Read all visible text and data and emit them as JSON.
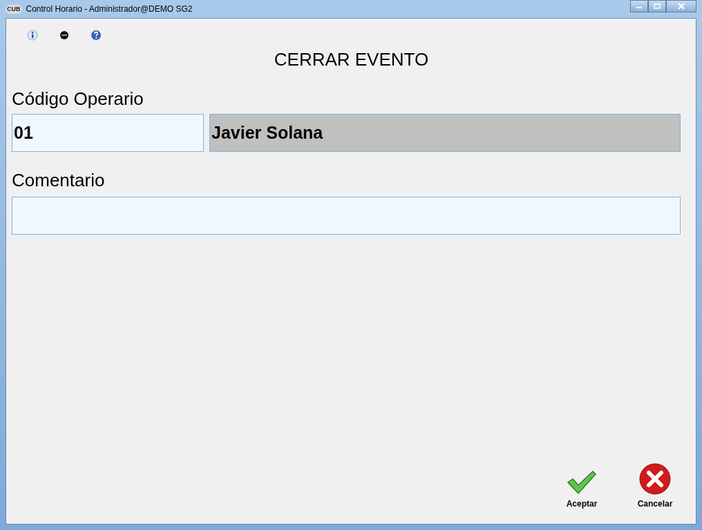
{
  "window": {
    "title": "Control Horario - Administrador@DEMO SG2",
    "app_icon": "CUB"
  },
  "heading": "CERRAR EVENTO",
  "operator": {
    "label": "Código Operario",
    "code": "01",
    "name": "Javier Solana"
  },
  "comment": {
    "label": "Comentario"
  },
  "buttons": [
    {
      "kind": "accept",
      "label": "Aceptar"
    },
    {
      "kind": "cancel",
      "label": "Cancelar"
    }
  ]
}
